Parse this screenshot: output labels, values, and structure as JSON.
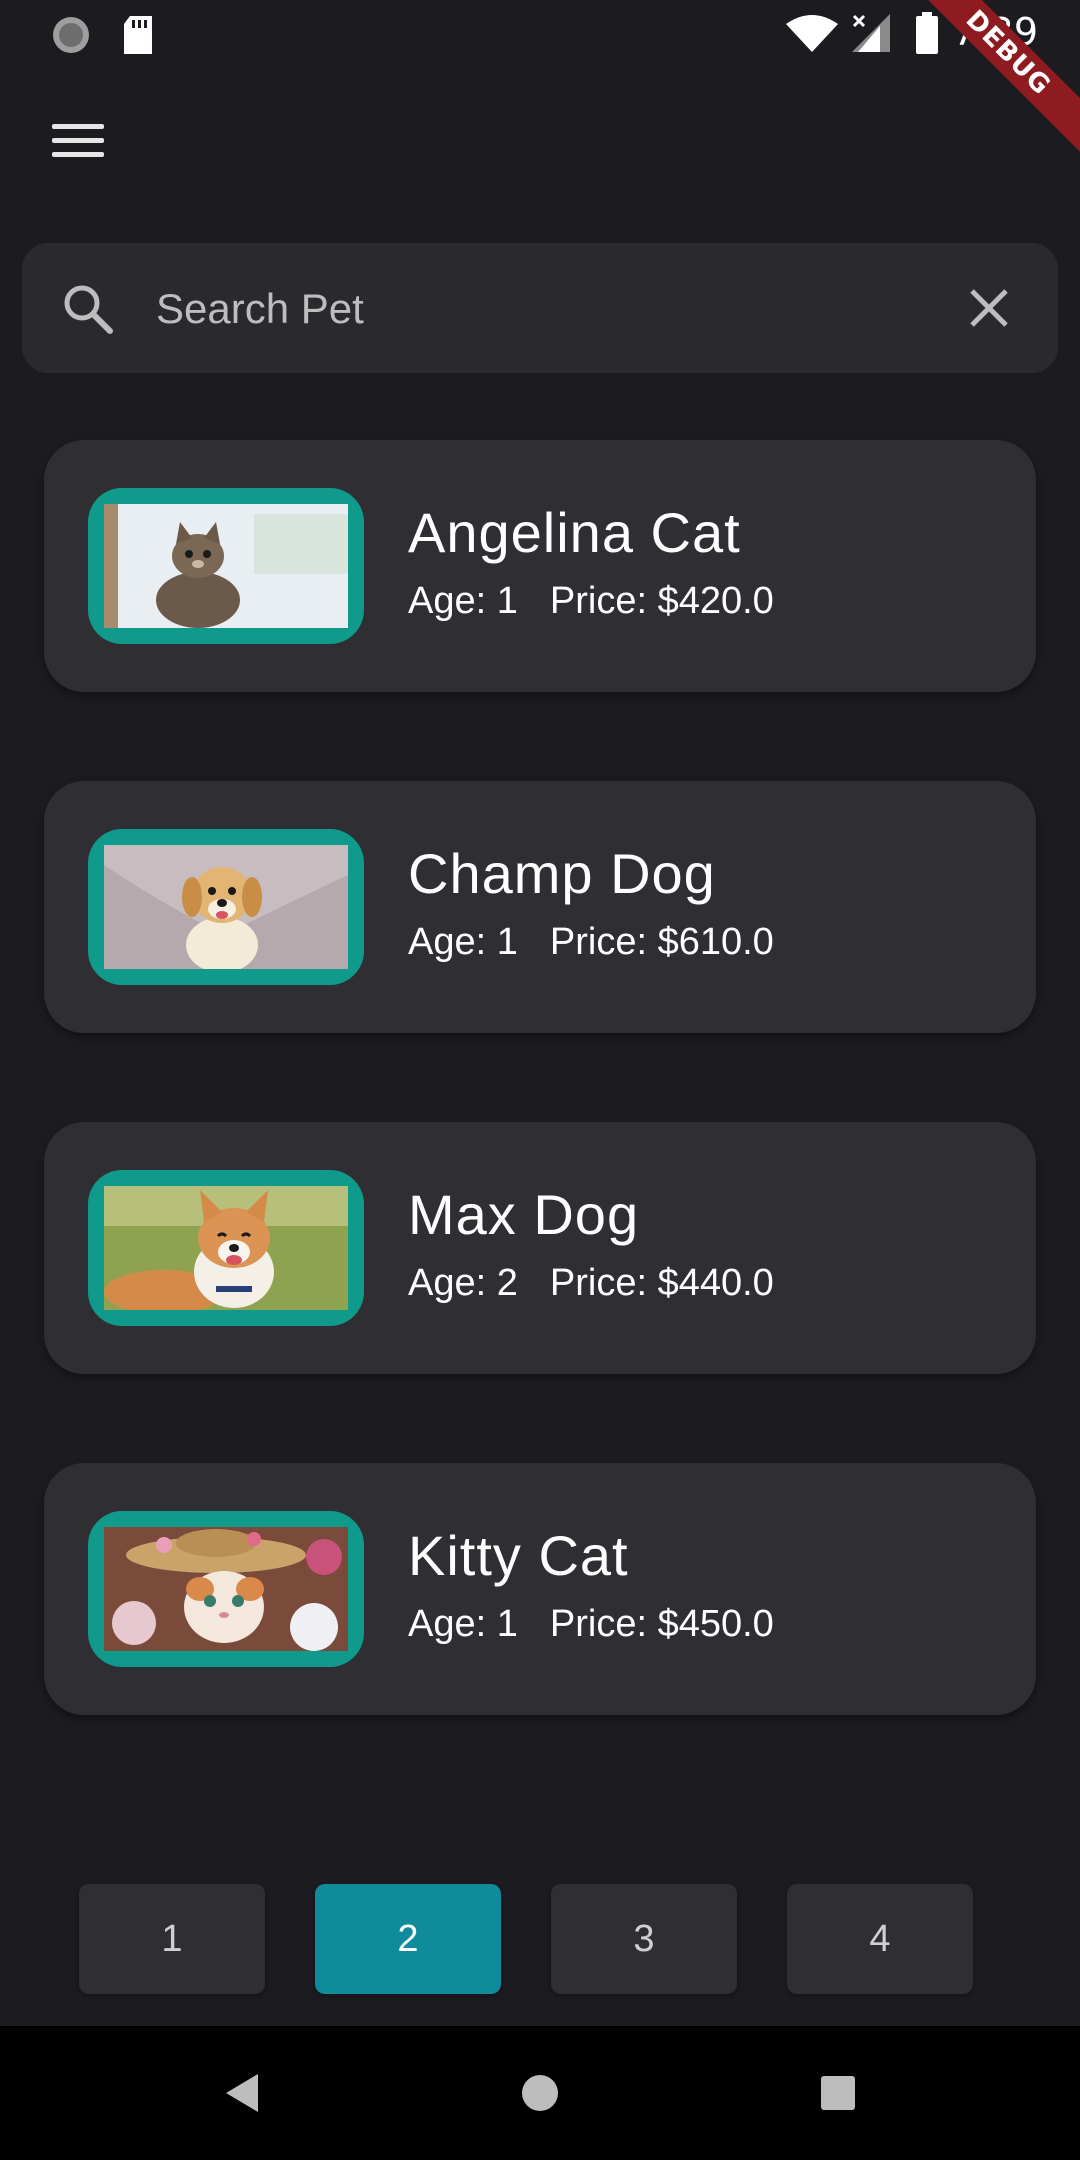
{
  "status_bar": {
    "time": "7:39",
    "debug_label": "DEBUG",
    "icons": [
      "loading-icon",
      "sd-card-icon",
      "wifi-icon",
      "signal-icon",
      "battery-icon"
    ]
  },
  "search": {
    "placeholder": "Search Pet",
    "value": ""
  },
  "pets": [
    {
      "name": "Angelina Cat",
      "age": "Age: 1",
      "price": "Price: $420.0",
      "image": "kitten-photo"
    },
    {
      "name": "Champ Dog",
      "age": "Age: 1",
      "price": "Price: $610.0",
      "image": "puppy-photo"
    },
    {
      "name": "Max Dog",
      "age": "Age: 2",
      "price": "Price: $440.0",
      "image": "corgi-photo"
    },
    {
      "name": "Kitty Cat",
      "age": "Age: 1",
      "price": "Price: $450.0",
      "image": "cat-with-hat-photo"
    }
  ],
  "pagination": {
    "pages": [
      "1",
      "2",
      "3",
      "4"
    ],
    "active": "2"
  },
  "colors": {
    "background": "#1c1b20",
    "card": "#2f2e33",
    "thumb_border": "#0f9a8c",
    "active_page": "#0f8b9c"
  }
}
